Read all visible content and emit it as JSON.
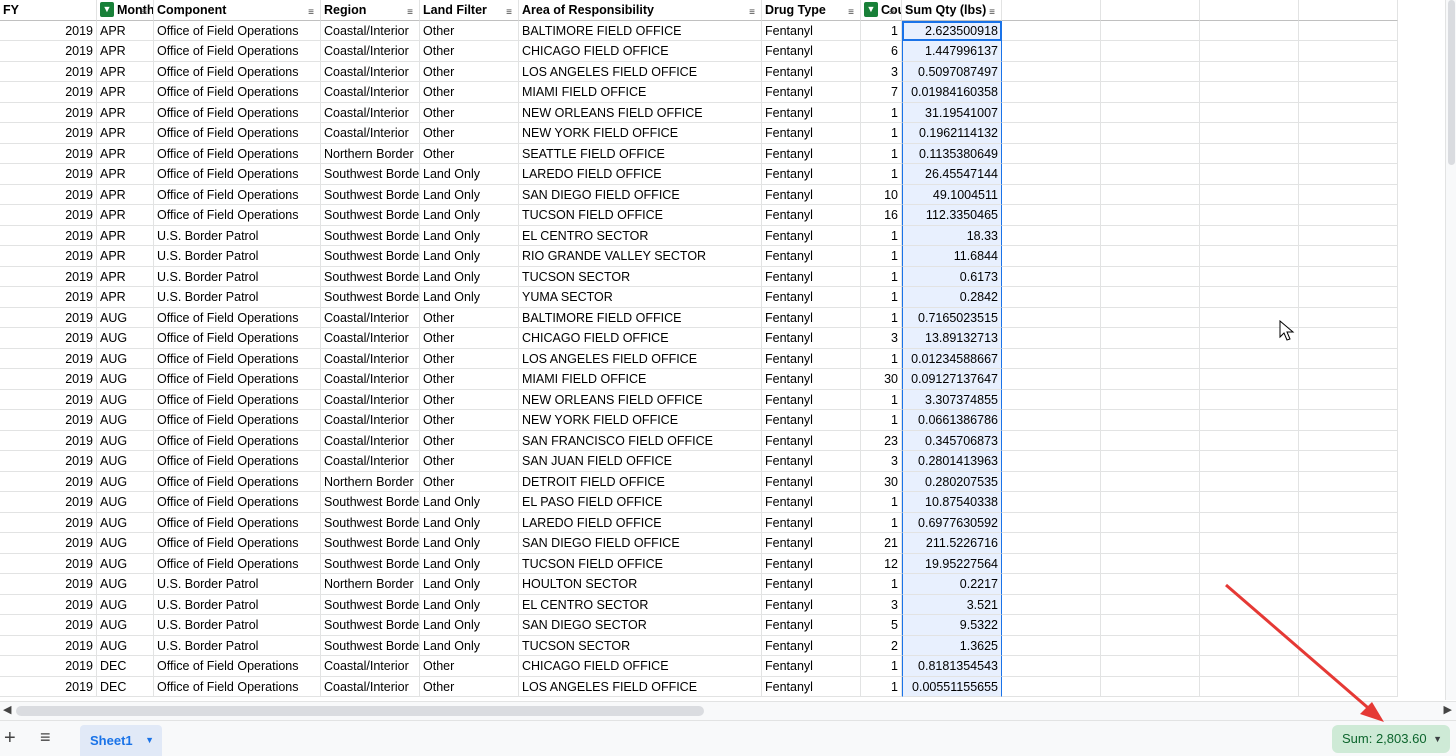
{
  "headers": [
    "FY",
    "Month",
    "Component",
    "Region",
    "Land Filter",
    "Area of Responsibility",
    "Drug Type",
    "Cou",
    "Sum Qty (lbs)"
  ],
  "rows": [
    [
      "2019",
      "APR",
      "Office of Field Operations",
      "Coastal/Interior",
      "Other",
      "BALTIMORE FIELD OFFICE",
      "Fentanyl",
      "1",
      "2.623500918"
    ],
    [
      "2019",
      "APR",
      "Office of Field Operations",
      "Coastal/Interior",
      "Other",
      "CHICAGO FIELD OFFICE",
      "Fentanyl",
      "6",
      "1.447996137"
    ],
    [
      "2019",
      "APR",
      "Office of Field Operations",
      "Coastal/Interior",
      "Other",
      "LOS ANGELES FIELD OFFICE",
      "Fentanyl",
      "3",
      "0.5097087497"
    ],
    [
      "2019",
      "APR",
      "Office of Field Operations",
      "Coastal/Interior",
      "Other",
      "MIAMI FIELD OFFICE",
      "Fentanyl",
      "7",
      "0.01984160358"
    ],
    [
      "2019",
      "APR",
      "Office of Field Operations",
      "Coastal/Interior",
      "Other",
      "NEW ORLEANS FIELD OFFICE",
      "Fentanyl",
      "1",
      "31.19541007"
    ],
    [
      "2019",
      "APR",
      "Office of Field Operations",
      "Coastal/Interior",
      "Other",
      "NEW YORK FIELD OFFICE",
      "Fentanyl",
      "1",
      "0.1962114132"
    ],
    [
      "2019",
      "APR",
      "Office of Field Operations",
      "Northern Border",
      "Other",
      "SEATTLE FIELD OFFICE",
      "Fentanyl",
      "1",
      "0.1135380649"
    ],
    [
      "2019",
      "APR",
      "Office of Field Operations",
      "Southwest Border",
      "Land Only",
      "LAREDO FIELD OFFICE",
      "Fentanyl",
      "1",
      "26.45547144"
    ],
    [
      "2019",
      "APR",
      "Office of Field Operations",
      "Southwest Border",
      "Land Only",
      "SAN DIEGO FIELD OFFICE",
      "Fentanyl",
      "10",
      "49.1004511"
    ],
    [
      "2019",
      "APR",
      "Office of Field Operations",
      "Southwest Border",
      "Land Only",
      "TUCSON FIELD OFFICE",
      "Fentanyl",
      "16",
      "112.3350465"
    ],
    [
      "2019",
      "APR",
      "U.S. Border Patrol",
      "Southwest Border",
      "Land Only",
      "EL CENTRO SECTOR",
      "Fentanyl",
      "1",
      "18.33"
    ],
    [
      "2019",
      "APR",
      "U.S. Border Patrol",
      "Southwest Border",
      "Land Only",
      "RIO GRANDE VALLEY SECTOR",
      "Fentanyl",
      "1",
      "11.6844"
    ],
    [
      "2019",
      "APR",
      "U.S. Border Patrol",
      "Southwest Border",
      "Land Only",
      "TUCSON SECTOR",
      "Fentanyl",
      "1",
      "0.6173"
    ],
    [
      "2019",
      "APR",
      "U.S. Border Patrol",
      "Southwest Border",
      "Land Only",
      "YUMA SECTOR",
      "Fentanyl",
      "1",
      "0.2842"
    ],
    [
      "2019",
      "AUG",
      "Office of Field Operations",
      "Coastal/Interior",
      "Other",
      "BALTIMORE FIELD OFFICE",
      "Fentanyl",
      "1",
      "0.7165023515"
    ],
    [
      "2019",
      "AUG",
      "Office of Field Operations",
      "Coastal/Interior",
      "Other",
      "CHICAGO FIELD OFFICE",
      "Fentanyl",
      "3",
      "13.89132713"
    ],
    [
      "2019",
      "AUG",
      "Office of Field Operations",
      "Coastal/Interior",
      "Other",
      "LOS ANGELES FIELD OFFICE",
      "Fentanyl",
      "1",
      "0.01234588667"
    ],
    [
      "2019",
      "AUG",
      "Office of Field Operations",
      "Coastal/Interior",
      "Other",
      "MIAMI FIELD OFFICE",
      "Fentanyl",
      "30",
      "0.09127137647"
    ],
    [
      "2019",
      "AUG",
      "Office of Field Operations",
      "Coastal/Interior",
      "Other",
      "NEW ORLEANS FIELD OFFICE",
      "Fentanyl",
      "1",
      "3.307374855"
    ],
    [
      "2019",
      "AUG",
      "Office of Field Operations",
      "Coastal/Interior",
      "Other",
      "NEW YORK FIELD OFFICE",
      "Fentanyl",
      "1",
      "0.0661386786"
    ],
    [
      "2019",
      "AUG",
      "Office of Field Operations",
      "Coastal/Interior",
      "Other",
      "SAN FRANCISCO FIELD OFFICE",
      "Fentanyl",
      "23",
      "0.345706873"
    ],
    [
      "2019",
      "AUG",
      "Office of Field Operations",
      "Coastal/Interior",
      "Other",
      "SAN JUAN FIELD OFFICE",
      "Fentanyl",
      "3",
      "0.2801413963"
    ],
    [
      "2019",
      "AUG",
      "Office of Field Operations",
      "Northern Border",
      "Other",
      "DETROIT FIELD OFFICE",
      "Fentanyl",
      "30",
      "0.280207535"
    ],
    [
      "2019",
      "AUG",
      "Office of Field Operations",
      "Southwest Border",
      "Land Only",
      "EL PASO FIELD OFFICE",
      "Fentanyl",
      "1",
      "10.87540338"
    ],
    [
      "2019",
      "AUG",
      "Office of Field Operations",
      "Southwest Border",
      "Land Only",
      "LAREDO FIELD OFFICE",
      "Fentanyl",
      "1",
      "0.6977630592"
    ],
    [
      "2019",
      "AUG",
      "Office of Field Operations",
      "Southwest Border",
      "Land Only",
      "SAN DIEGO FIELD OFFICE",
      "Fentanyl",
      "21",
      "211.5226716"
    ],
    [
      "2019",
      "AUG",
      "Office of Field Operations",
      "Southwest Border",
      "Land Only",
      "TUCSON FIELD OFFICE",
      "Fentanyl",
      "12",
      "19.95227564"
    ],
    [
      "2019",
      "AUG",
      "U.S. Border Patrol",
      "Northern Border",
      "Land Only",
      "HOULTON SECTOR",
      "Fentanyl",
      "1",
      "0.2217"
    ],
    [
      "2019",
      "AUG",
      "U.S. Border Patrol",
      "Southwest Border",
      "Land Only",
      "EL CENTRO SECTOR",
      "Fentanyl",
      "3",
      "3.521"
    ],
    [
      "2019",
      "AUG",
      "U.S. Border Patrol",
      "Southwest Border",
      "Land Only",
      "SAN DIEGO SECTOR",
      "Fentanyl",
      "5",
      "9.5322"
    ],
    [
      "2019",
      "AUG",
      "U.S. Border Patrol",
      "Southwest Border",
      "Land Only",
      "TUCSON SECTOR",
      "Fentanyl",
      "2",
      "1.3625"
    ],
    [
      "2019",
      "DEC",
      "Office of Field Operations",
      "Coastal/Interior",
      "Other",
      "CHICAGO FIELD OFFICE",
      "Fentanyl",
      "1",
      "0.8181354543"
    ],
    [
      "2019",
      "DEC",
      "Office of Field Operations",
      "Coastal/Interior",
      "Other",
      "LOS ANGELES FIELD OFFICE",
      "Fentanyl",
      "1",
      "0.00551155655"
    ]
  ],
  "sheet_tab": "Sheet1",
  "sum_label": "Sum: 2,803.60",
  "colors": {
    "accent": "#1a73e8",
    "filter_active": "#188038",
    "sum_bg": "#ceead6"
  }
}
